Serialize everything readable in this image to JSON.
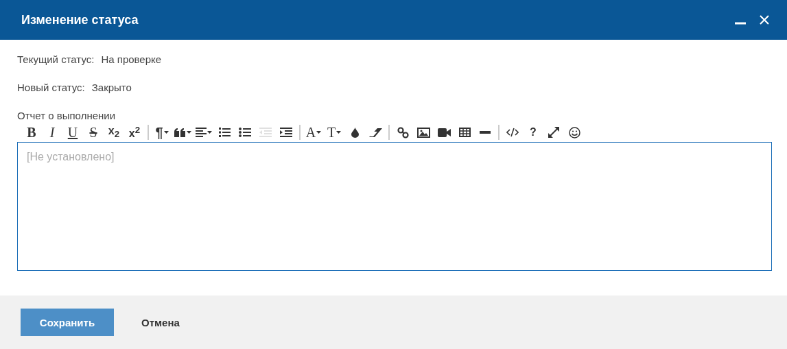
{
  "window": {
    "title": "Изменение статуса"
  },
  "fields": [
    {
      "label": "Текущий статус:",
      "value": "На проверке"
    },
    {
      "label": "Новый статус:",
      "value": "Закрыто"
    }
  ],
  "editor": {
    "label": "Отчет о выполнении",
    "placeholder": "[Не установлено]",
    "toolbar": [
      [
        {
          "kind": "bold",
          "label": "B",
          "dropdown": false,
          "disabled": false
        },
        {
          "kind": "italic",
          "label": "I",
          "dropdown": false,
          "disabled": false
        },
        {
          "kind": "underline",
          "label": "U",
          "dropdown": false,
          "disabled": false
        },
        {
          "kind": "strike",
          "label": "S",
          "dropdown": false,
          "disabled": false
        },
        {
          "kind": "subscript",
          "label": "x$_{2}$",
          "dropdown": false,
          "disabled": false
        },
        {
          "kind": "superscript",
          "label": "x$^{2}$",
          "dropdown": false,
          "disabled": false
        }
      ],
      [
        {
          "kind": "paragraph",
          "label": "¶",
          "dropdown": true,
          "disabled": false
        },
        {
          "kind": "quote",
          "dropdown": true,
          "disabled": false
        },
        {
          "kind": "align",
          "dropdown": true,
          "disabled": false
        },
        {
          "kind": "ordered-list",
          "dropdown": false,
          "disabled": false
        },
        {
          "kind": "bullet-list",
          "dropdown": false,
          "disabled": false
        },
        {
          "kind": "outdent",
          "dropdown": false,
          "disabled": true
        },
        {
          "kind": "indent",
          "dropdown": false,
          "disabled": false
        }
      ],
      [
        {
          "kind": "font-family",
          "label": "A",
          "dropdown": true,
          "disabled": false
        },
        {
          "kind": "font-size",
          "label": "T",
          "dropdown": true,
          "disabled": false
        },
        {
          "kind": "color",
          "dropdown": false,
          "disabled": false
        },
        {
          "kind": "eraser",
          "dropdown": false,
          "disabled": false
        }
      ],
      [
        {
          "kind": "link",
          "dropdown": false,
          "disabled": false
        },
        {
          "kind": "image",
          "dropdown": false,
          "disabled": false
        },
        {
          "kind": "video",
          "dropdown": false,
          "disabled": false
        },
        {
          "kind": "table",
          "dropdown": false,
          "disabled": false
        },
        {
          "kind": "hr",
          "dropdown": false,
          "disabled": false
        }
      ],
      [
        {
          "kind": "code",
          "dropdown": false,
          "disabled": false
        },
        {
          "kind": "help",
          "label": "?",
          "dropdown": false,
          "disabled": false
        },
        {
          "kind": "fullscreen",
          "dropdown": false,
          "disabled": false
        },
        {
          "kind": "emoji",
          "dropdown": false,
          "disabled": false
        }
      ]
    ]
  },
  "buttons": [
    {
      "label": "Сохранить",
      "kind": "primary"
    },
    {
      "label": "Отмена",
      "kind": "plain"
    }
  ]
}
